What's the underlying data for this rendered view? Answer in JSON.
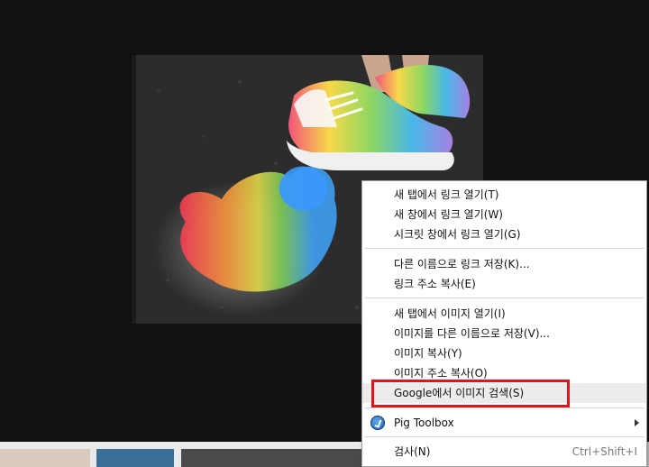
{
  "context_menu": {
    "items": [
      {
        "label": "새 탭에서 링크 열기(T)"
      },
      {
        "label": "새 창에서 링크 열기(W)"
      },
      {
        "label": "시크릿 창에서 링크 열기(G)"
      },
      {
        "label": "다른 이름으로 링크 저장(K)..."
      },
      {
        "label": "링크 주소 복사(E)"
      },
      {
        "label": "새 탭에서 이미지 열기(I)"
      },
      {
        "label": "이미지를 다른 이름으로 저장(V)..."
      },
      {
        "label": "이미지 복사(Y)"
      },
      {
        "label": "이미지 주소 복사(O)"
      },
      {
        "label": "Google에서 이미지 검색(S)"
      },
      {
        "label": "Pig Toolbox"
      },
      {
        "label": "검사(N)",
        "shortcut": "Ctrl+Shift+I"
      }
    ]
  },
  "colors": {
    "highlight_box": "#e3131b",
    "menu_hover": "#ececec"
  },
  "icons": {
    "extension": "pig-toolbox-icon",
    "submenu": "submenu-arrow-icon"
  }
}
